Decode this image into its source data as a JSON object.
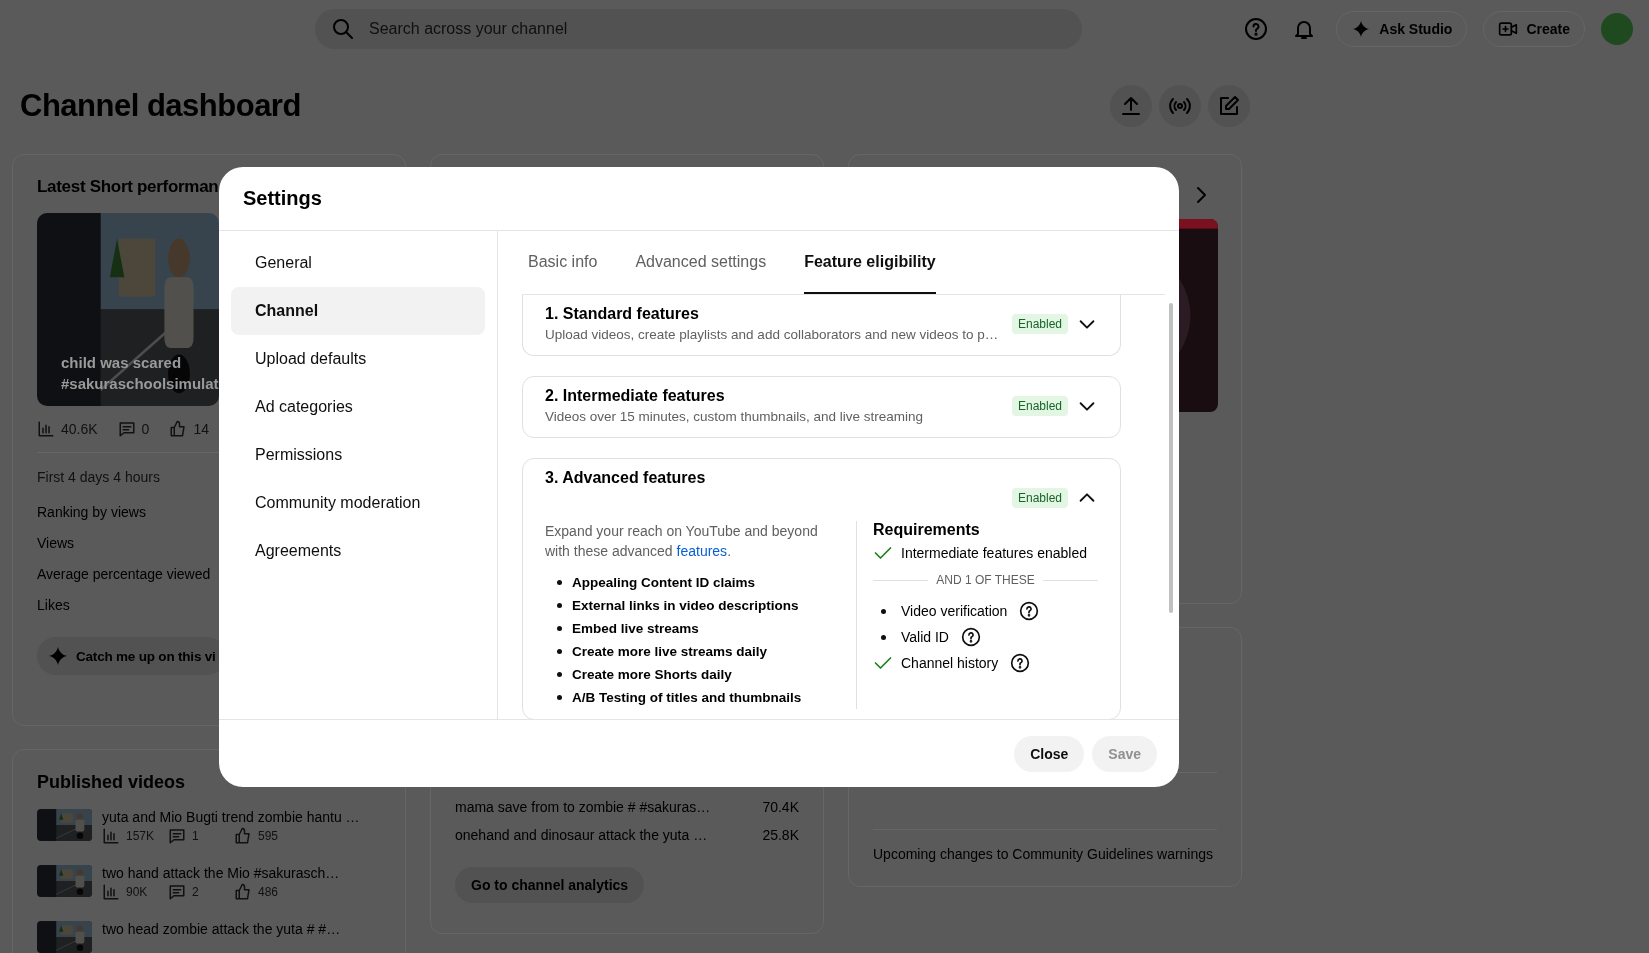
{
  "topbar": {
    "search": {
      "placeholder": "Search across your channel"
    },
    "buttons": [
      {
        "label": "Ask Studio",
        "kind": "sparkle"
      },
      {
        "label": "Create",
        "kind": "create"
      }
    ]
  },
  "page": {
    "title": "Channel dashboard"
  },
  "latest_short": {
    "title": "Latest Short performan",
    "caption": "child was scared",
    "caption_tags": "#sakuraschoolsimulat",
    "stats": [
      {
        "kind": "views",
        "value": "40.6K"
      },
      {
        "kind": "comments",
        "value": "0"
      },
      {
        "kind": "likes",
        "value": "14"
      }
    ],
    "period": "First 4 days 4 hours",
    "metrics": [
      "Ranking by views",
      "Views",
      "Average percentage viewed",
      "Likes"
    ],
    "action": "Catch me up on this vi"
  },
  "published_videos": {
    "title": "Published videos",
    "rows": [
      {
        "title": "yuta and Mio Bugti trend zombie hantu …",
        "views": "157K",
        "comments": "1",
        "likes": "595"
      },
      {
        "title": "two hand attack the Mio #sakurasch…",
        "views": "90K",
        "comments": "2",
        "likes": "486"
      },
      {
        "title": "two head zombie attack the yuta # #…"
      }
    ]
  },
  "analytics": {
    "rows": [
      {
        "title": "mama save from to zombie # #sakuras…",
        "value": "70.4K"
      },
      {
        "title": "onehand and dinosaur attack the yuta …",
        "value": "25.8K"
      }
    ],
    "button": "Go to channel analytics"
  },
  "news": {
    "items": [
      "Upcoming changes to Community Guidelines warnings"
    ]
  },
  "settings": {
    "title": "Settings",
    "nav": [
      {
        "label": "General",
        "selected": false
      },
      {
        "label": "Channel",
        "selected": true
      },
      {
        "label": "Upload defaults",
        "selected": false
      },
      {
        "label": "Ad categories",
        "selected": false
      },
      {
        "label": "Permissions",
        "selected": false
      },
      {
        "label": "Community moderation",
        "selected": false
      },
      {
        "label": "Agreements",
        "selected": false
      }
    ],
    "tabs": [
      {
        "label": "Basic info",
        "selected": false
      },
      {
        "label": "Advanced settings",
        "selected": false
      },
      {
        "label": "Feature eligibility",
        "selected": true
      }
    ],
    "features": [
      {
        "title": "1. Standard features",
        "description": "Upload videos, create playlists and add collaborators and new videos to p…",
        "status": "Enabled",
        "expanded": false
      },
      {
        "title": "2. Intermediate features",
        "description": "Videos over 15 minutes, custom thumbnails, and live streaming",
        "status": "Enabled",
        "expanded": false
      },
      {
        "title": "3. Advanced features",
        "status": "Enabled",
        "expanded": true,
        "intro": "Expand your reach on YouTube and beyond with these advanced ",
        "link": "features",
        "intro_end": ".",
        "benefits": [
          "Appealing Content ID claims",
          "External links in video descriptions",
          "Embed live streams",
          "Create more live streams daily",
          "Create more Shorts daily",
          "A/B Testing of titles and thumbnails"
        ],
        "requirements_title": "Requirements",
        "requirements": [
          {
            "label": "Intermediate features enabled",
            "kind": "met"
          }
        ],
        "divider": "AND 1 OF THESE",
        "options": [
          {
            "label": "Video verification",
            "kind": "bullet"
          },
          {
            "label": "Valid ID",
            "kind": "bullet"
          },
          {
            "label": "Channel history",
            "kind": "met"
          }
        ]
      }
    ],
    "buttons": [
      {
        "label": "Close",
        "disabled": false
      },
      {
        "label": "Save",
        "disabled": true
      }
    ]
  }
}
